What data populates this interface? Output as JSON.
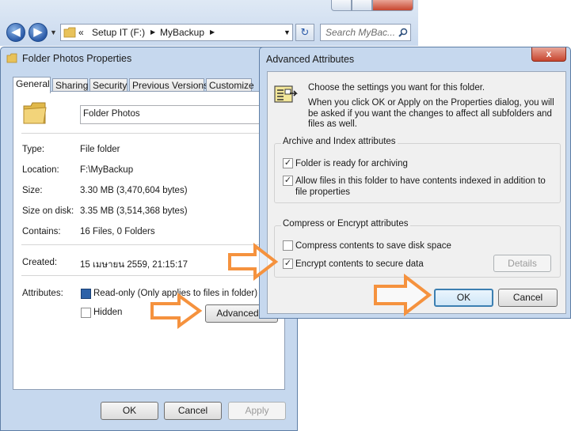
{
  "explorer": {
    "nav_prefix": "«",
    "breadcrumbs": [
      "Setup IT (F:)",
      "MyBackup"
    ],
    "search_placeholder": "Search MyBac..."
  },
  "properties": {
    "title": "Folder Photos Properties",
    "tabs": [
      "General",
      "Sharing",
      "Security",
      "Previous Versions",
      "Customize"
    ],
    "folder_name": "Folder Photos",
    "rows": [
      {
        "label": "Type:",
        "value": "File folder"
      },
      {
        "label": "Location:",
        "value": "F:\\MyBackup"
      },
      {
        "label": "Size:",
        "value": "3.30 MB (3,470,604 bytes)"
      },
      {
        "label": "Size on disk:",
        "value": "3.35 MB (3,514,368 bytes)"
      },
      {
        "label": "Contains:",
        "value": "16 Files, 0 Folders"
      }
    ],
    "created_label": "Created:",
    "created_value": "15 เมษายน 2559, 21:15:17",
    "attributes_label": "Attributes:",
    "readonly_label": "Read-only (Only applies to files in folder)",
    "hidden_label": "Hidden",
    "advanced_button": "Advanced...",
    "ok": "OK",
    "cancel": "Cancel",
    "apply": "Apply"
  },
  "advanced": {
    "title": "Advanced Attributes",
    "close": "x",
    "intro_line1": "Choose the settings you want for this folder.",
    "intro_line2": "When you click OK or Apply on the Properties dialog, you will be asked if you want the changes to affect all subfolders and files as well.",
    "archive_group_label": "Archive and Index attributes",
    "archive_checkbox": "Folder is ready for archiving",
    "index_checkbox": "Allow files in this folder to have contents indexed in addition to file properties",
    "compress_group_label": "Compress or Encrypt attributes",
    "compress_checkbox": "Compress contents to save disk space",
    "encrypt_checkbox": "Encrypt contents to secure data",
    "details_button": "Details",
    "ok": "OK",
    "cancel": "Cancel"
  },
  "colors": {
    "arrow": "#f5923e",
    "title_bar": "#c6d8ee",
    "ok_focus": "#3c7fb1"
  }
}
